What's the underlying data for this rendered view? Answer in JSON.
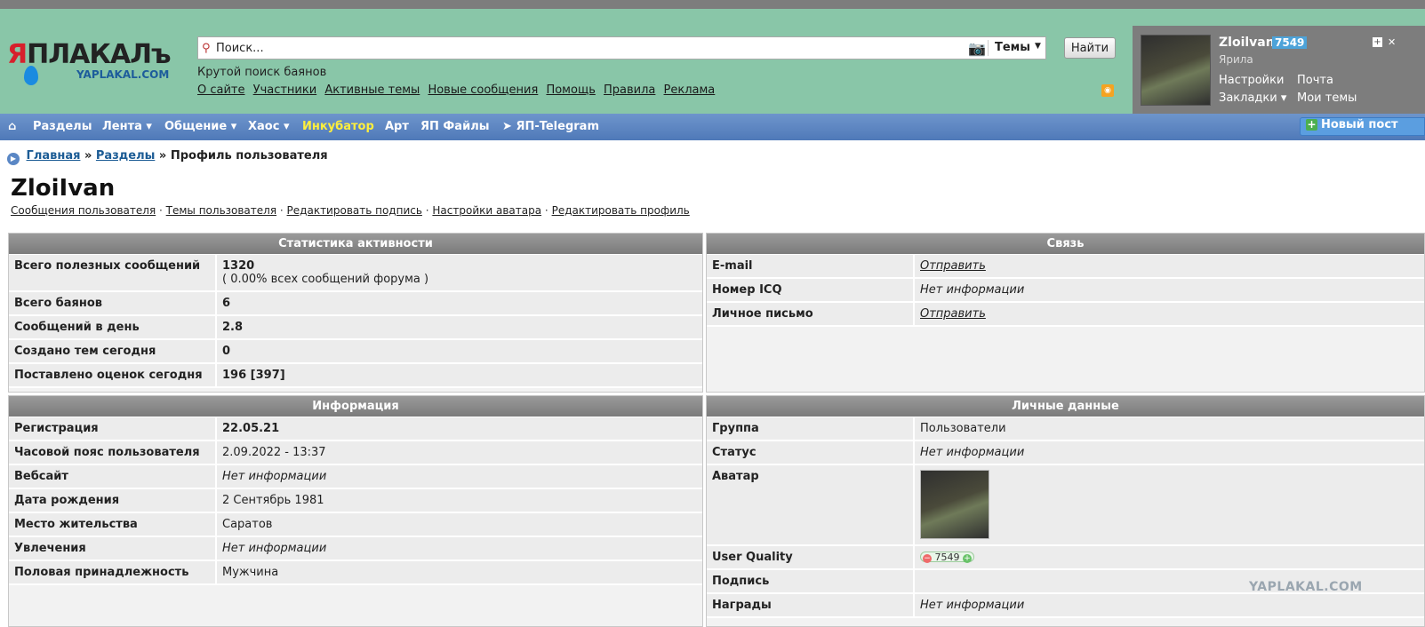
{
  "logo": {
    "line1_red": "Я",
    "line1": "ПЛАКАЛъ",
    "line2": "YAPLAKAL.COM"
  },
  "search": {
    "placeholder": "Поиск...",
    "scope": "Темы",
    "find_label": "Найти",
    "hint": "Крутой поиск баянов"
  },
  "top_links": [
    "О сайте",
    "Участники",
    "Активные темы",
    "Новые сообщения",
    "Помощь",
    "Правила",
    "Реклама"
  ],
  "user": {
    "name": "Zloilvan",
    "karma": "7549",
    "rank": "Ярила",
    "links_left": [
      "Настройки",
      "Закладки ▾"
    ],
    "links_right": [
      "Почта",
      "Мои темы"
    ]
  },
  "nav": {
    "home_icon": "home-icon",
    "items": [
      "Разделы",
      "Лента ▾",
      "Общение ▾",
      "Хаос ▾",
      "Инкубатор",
      "Арт",
      "ЯП Файлы",
      "ЯП-Telegram"
    ],
    "new_post": "Новый пост"
  },
  "breadcrumb": {
    "home": "Главная",
    "sep": "»",
    "sections": "Разделы",
    "current": "Профиль пользователя"
  },
  "profile": {
    "title": "ZloiIvan",
    "links": [
      "Сообщения пользователя",
      "Темы пользователя",
      "Редактировать подпись",
      "Настройки аватара",
      "Редактировать профиль"
    ],
    "link_sep": "·"
  },
  "stats": {
    "header": "Статистика активности",
    "rows": [
      {
        "k": "Всего полезных сообщений",
        "v": "1320",
        "sub": "( 0.00% всех сообщений форума )"
      },
      {
        "k": "Всего баянов",
        "v": "6"
      },
      {
        "k": "Сообщений в день",
        "v": "2.8"
      },
      {
        "k": "Создано тем сегодня",
        "v": "0"
      },
      {
        "k": "Поставлено оценок сегодня",
        "v": "196 [397]"
      }
    ]
  },
  "contact": {
    "header": "Связь",
    "rows": [
      {
        "k": "E-mail",
        "v": "Отправить"
      },
      {
        "k": "Номер ICQ",
        "v": "Нет информации"
      },
      {
        "k": "Личное письмо",
        "v": "Отправить"
      }
    ]
  },
  "info": {
    "header": "Информация",
    "rows": [
      {
        "k": "Регистрация",
        "v": "22.05.21"
      },
      {
        "k": "Часовой пояс пользователя",
        "v": "2.09.2022 - 13:37"
      },
      {
        "k": "Вебсайт",
        "v": "Нет информации"
      },
      {
        "k": "Дата рождения",
        "v": "2 Сентябрь 1981"
      },
      {
        "k": "Место жительства",
        "v": "Саратов"
      },
      {
        "k": "Увлечения",
        "v": "Нет информации"
      },
      {
        "k": "Половая принадлежность",
        "v": "Мужчина"
      }
    ]
  },
  "personal": {
    "header": "Личные данные",
    "rows": [
      {
        "k": "Группа",
        "v": "Пользователи"
      },
      {
        "k": "Статус",
        "v": "Нет информации"
      },
      {
        "k": "Аватар",
        "v": ""
      },
      {
        "k": "User Quality",
        "v": "7549"
      },
      {
        "k": "Подпись",
        "v": ""
      },
      {
        "k": "Награды",
        "v": "Нет информации"
      }
    ]
  },
  "watermark": "YAPLAKAL.COM"
}
